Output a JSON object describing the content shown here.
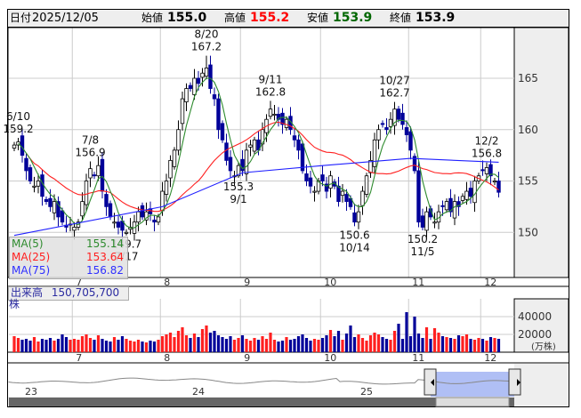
{
  "header": {
    "date_label": "日付",
    "date": "2025/12/05",
    "open_label": "始値",
    "open": "155.0",
    "high_label": "高値",
    "high": "155.2",
    "low_label": "安値",
    "low": "153.9",
    "close_label": "終値",
    "close": "153.9"
  },
  "colors": {
    "up_fill": "#ffffff",
    "down_fill": "#000099",
    "ma5": "#2e8b2e",
    "ma25": "#ff2020",
    "ma75": "#2020ff",
    "vol_up": "#ff2020",
    "vol_down": "#000099",
    "high_text": "#ff0000",
    "low_text": "#006600"
  },
  "price_axis": {
    "ticks": [
      "165",
      "160",
      "155",
      "150"
    ]
  },
  "months": [
    {
      "label": "7",
      "start": 15
    },
    {
      "label": "8",
      "start": 37
    },
    {
      "label": "9",
      "start": 57
    },
    {
      "label": "10",
      "start": 77
    },
    {
      "label": "11",
      "start": 99
    },
    {
      "label": "12",
      "start": 117
    }
  ],
  "closes": [
    158.5,
    158.8,
    157.5,
    156,
    155,
    154.5,
    155,
    153.5,
    153,
    152.5,
    153,
    151.5,
    151,
    150.5,
    150.8,
    150.5,
    151,
    153,
    155,
    156.2,
    155.5,
    156.5,
    154,
    152.5,
    151.5,
    151,
    150.5,
    150.2,
    150,
    150.5,
    151,
    152,
    151.5,
    152,
    151.8,
    151,
    151.5,
    154,
    155,
    157,
    158,
    160,
    163,
    164,
    164,
    165,
    164.5,
    165.5,
    166,
    164,
    163,
    160,
    159,
    157,
    156,
    155.5,
    156.5,
    156,
    158,
    158.5,
    159,
    158,
    160,
    161,
    162,
    161.5,
    161,
    160.5,
    161,
    160,
    159,
    158,
    156,
    155,
    154.5,
    154,
    155,
    155,
    154,
    155.5,
    154.5,
    153,
    154,
    153,
    152.5,
    151,
    152,
    154,
    155.5,
    157,
    159,
    160,
    160.5,
    160,
    161,
    162,
    161,
    160.5,
    159.5,
    158,
    156,
    151,
    150.5,
    152,
    151.5,
    151,
    152,
    152.5,
    153,
    152,
    153,
    152.5,
    153.5,
    154,
    153.5,
    155,
    155.5,
    156,
    156.3,
    155.5,
    155,
    153.9
  ],
  "volumes": [
    18000,
    16000,
    14000,
    15000,
    13000,
    17000,
    12000,
    15000,
    14000,
    16000,
    13000,
    15000,
    20000,
    17000,
    14000,
    15000,
    14000,
    18000,
    20000,
    16000,
    14000,
    19000,
    15000,
    13000,
    12000,
    17000,
    14000,
    18000,
    15000,
    13000,
    12000,
    14000,
    12000,
    11000,
    13000,
    12000,
    14000,
    18000,
    20000,
    22000,
    17000,
    24000,
    28000,
    19000,
    16000,
    21000,
    17000,
    26000,
    30000,
    22000,
    24000,
    19000,
    17000,
    15000,
    18000,
    14000,
    16000,
    19000,
    15000,
    13000,
    16000,
    14000,
    18000,
    15000,
    22000,
    14000,
    12000,
    13000,
    17000,
    14000,
    15000,
    18000,
    20000,
    16000,
    13000,
    15000,
    14000,
    16000,
    19000,
    25000,
    18000,
    24000,
    14000,
    21000,
    30000,
    17000,
    20000,
    16000,
    13000,
    19000,
    22000,
    20000,
    17000,
    15000,
    14000,
    24000,
    32000,
    15000,
    45000,
    18000,
    40000,
    21000,
    16000,
    28000,
    15000,
    27000,
    22000,
    18000,
    17000,
    16000,
    15000,
    19000,
    18000,
    20000,
    15000,
    14000,
    16000,
    15000,
    13000,
    17000,
    16000,
    15000
  ],
  "ma75_points": [
    [
      0,
      149.7
    ],
    [
      37,
      152.5
    ],
    [
      57,
      155.8
    ],
    [
      77,
      156.5
    ],
    [
      99,
      157.2
    ],
    [
      121,
      156.82
    ]
  ],
  "annotations": [
    {
      "idx": 1,
      "price": 159.2,
      "pos": "above",
      "lines": [
        "6/10",
        "159.2"
      ]
    },
    {
      "idx": 19,
      "price": 156.9,
      "pos": "above",
      "lines": [
        "7/8",
        "156.9"
      ]
    },
    {
      "idx": 28,
      "price": 149.7,
      "pos": "below",
      "lines": [
        "149.7",
        "7/17"
      ]
    },
    {
      "idx": 48,
      "price": 167.2,
      "pos": "above",
      "lines": [
        "8/20",
        "167.2"
      ]
    },
    {
      "idx": 56,
      "price": 155.3,
      "pos": "below",
      "lines": [
        "155.3",
        "9/1"
      ]
    },
    {
      "idx": 64,
      "price": 162.8,
      "pos": "above",
      "lines": [
        "9/11",
        "162.8"
      ]
    },
    {
      "idx": 85,
      "price": 150.6,
      "pos": "below",
      "lines": [
        "150.6",
        "10/14"
      ]
    },
    {
      "idx": 95,
      "price": 162.7,
      "pos": "above",
      "lines": [
        "10/27",
        "162.7"
      ]
    },
    {
      "idx": 102,
      "price": 150.2,
      "pos": "below",
      "lines": [
        "150.2",
        "11/5"
      ]
    },
    {
      "idx": 118,
      "price": 156.8,
      "pos": "above",
      "lines": [
        "12/2",
        "156.8"
      ]
    }
  ],
  "legend": [
    {
      "name": "MA(5)",
      "value": "155.14"
    },
    {
      "name": "MA(25)",
      "value": "153.64"
    },
    {
      "name": "MA(75)",
      "value": "156.82"
    }
  ],
  "volume": {
    "label": "出来高",
    "value": "150,705,700株",
    "ticks": [
      "40000",
      "20000"
    ],
    "unit": "(万株)"
  },
  "navigator": {
    "years": [
      "23",
      "24",
      "25"
    ]
  }
}
